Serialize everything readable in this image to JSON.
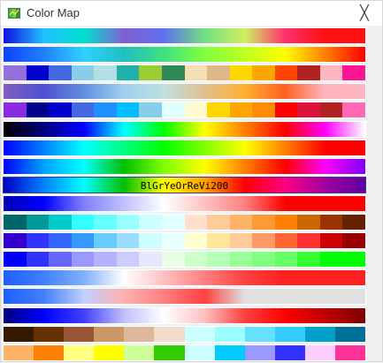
{
  "window": {
    "title": "Color Map",
    "close_glyph": "╳",
    "app_icon": "map-icon"
  },
  "colormaps": [
    {
      "type": "gradient",
      "stops": [
        "#1010e0",
        "#20c0ff",
        "#00e0d0",
        "#8060d0",
        "#6070f0",
        "#70e080",
        "#d0f060",
        "#ff3070",
        "#ff1010",
        "#ff1010"
      ]
    },
    {
      "type": "gradient",
      "stops": [
        "#1040ff",
        "#2080ff",
        "#30d0ff",
        "#20c0c0",
        "#40e080",
        "#80ff40",
        "#c0ff20",
        "#ffff00",
        "#ff8000",
        "#ff0000"
      ]
    },
    {
      "type": "discrete",
      "colors": [
        "#9370db",
        "#0000cd",
        "#4169e1",
        "#87ceeb",
        "#b0e0e6",
        "#20b2aa",
        "#9acd32",
        "#2e8b57",
        "#f5deb3",
        "#deb887",
        "#ffd700",
        "#ffa500",
        "#ff4500",
        "#b22222",
        "#ffb6c1",
        "#ff1493"
      ]
    },
    {
      "type": "gradient",
      "stops": [
        "#8060c0",
        "#5050d0",
        "#6090e0",
        "#a0d0f0",
        "#c0e0e0",
        "#e0c090",
        "#ffb030",
        "#ff6020",
        "#ffb6c1",
        "#ffb6c1"
      ]
    },
    {
      "type": "discrete",
      "colors": [
        "#8a2be2",
        "#00008b",
        "#0000cd",
        "#4169e1",
        "#1e90ff",
        "#00bfff",
        "#87ceeb",
        "#e0ffff",
        "#fffacd",
        "#ffd700",
        "#ffa500",
        "#ff8c00",
        "#ff0000",
        "#dc143c",
        "#b22222",
        "#ff69b4"
      ]
    },
    {
      "type": "gradient",
      "stops": [
        "#000000",
        "#000080",
        "#0000ff",
        "#00ffff",
        "#00ff00",
        "#ffff00",
        "#ff8000",
        "#ff0000",
        "#ff00ff",
        "#ffffff"
      ]
    },
    {
      "type": "gradient",
      "stops": [
        "#0000ff",
        "#0080ff",
        "#00ffff",
        "#00ff80",
        "#00ff00",
        "#80ff00",
        "#ffff00",
        "#ff8000",
        "#ff0000",
        "#ff0000"
      ]
    },
    {
      "type": "gradient",
      "stops": [
        "#0000ff",
        "#00a0ff",
        "#00ffff",
        "#00c000",
        "#80ff00",
        "#ffff00",
        "#ff8000",
        "#ff0000",
        "#ff00ff",
        "#8000ff"
      ]
    },
    {
      "type": "gradient",
      "label": "BlGrYeOrReVi200",
      "selected": true,
      "stops": [
        "#0000c0",
        "#0080ff",
        "#00ffff",
        "#00c000",
        "#ffff00",
        "#ffa000",
        "#ff0000",
        "#ff0080",
        "#a000a0",
        "#6000a0"
      ]
    },
    {
      "type": "gradient",
      "stops": [
        "#0000b0",
        "#0000ff",
        "#8080ff",
        "#c0c0ff",
        "#ffffff",
        "#ffc0c0",
        "#ff8080",
        "#ff0000",
        "#ff0000",
        "#ff0000"
      ]
    },
    {
      "type": "discrete",
      "colors": [
        "#006666",
        "#009999",
        "#00cccc",
        "#33ffff",
        "#66ffff",
        "#99ffff",
        "#ccffff",
        "#e0ffff",
        "#ffe0cc",
        "#ffcc99",
        "#ffb366",
        "#ff9933",
        "#ff8000",
        "#cc6600",
        "#993300",
        "#662200"
      ]
    },
    {
      "type": "discrete",
      "colors": [
        "#3300cc",
        "#3333ff",
        "#3366ff",
        "#3399ff",
        "#66ccff",
        "#99ddff",
        "#ccffff",
        "#e6ffff",
        "#ffffcc",
        "#ffe699",
        "#ffcc99",
        "#ff9966",
        "#ff6633",
        "#ff3333",
        "#cc0000",
        "#990000"
      ]
    },
    {
      "type": "discrete",
      "colors": [
        "#0000ff",
        "#3333ff",
        "#6666ff",
        "#9999ff",
        "#b3b3ff",
        "#ccccff",
        "#e6e6ff",
        "#e6ffe6",
        "#ccffcc",
        "#b3ffb3",
        "#99ff99",
        "#80ff80",
        "#66ff66",
        "#33ff33",
        "#00ff00",
        "#00ff00"
      ]
    },
    {
      "type": "gradient",
      "stops": [
        "#2060ff",
        "#4080ff",
        "#80b0ff",
        "#ffffff",
        "#ffc0c0",
        "#ff8080",
        "#ff4040",
        "#ff2020",
        "#ff2020",
        "#ff2020"
      ]
    },
    {
      "type": "gradient",
      "stops": [
        "#2060ff",
        "#4080ff",
        "#c0d0ff",
        "#ffb0b0",
        "#ff8080",
        "#ff4040",
        "#e0e0e0",
        "#e0e0e0",
        "#e0e0e0",
        "#e0e0e0"
      ]
    },
    {
      "type": "gradient",
      "stops": [
        "#000080",
        "#0000ff",
        "#4040ff",
        "#c0c0ff",
        "#ffffff",
        "#ffc0c0",
        "#ff4040",
        "#ff0000",
        "#c00000",
        "#800000"
      ]
    },
    {
      "type": "discrete",
      "colors": [
        "#331a00",
        "#663300",
        "#995533",
        "#cc9966",
        "#ddb89a",
        "#f0dcc8",
        "#ccffff",
        "#99ffff",
        "#66e0ff",
        "#33ccff",
        "#00a0cc",
        "#007099"
      ]
    },
    {
      "type": "discrete",
      "colors": [
        "#ffb366",
        "#ff8000",
        "#ffff80",
        "#ffff00",
        "#ccff99",
        "#33cc00",
        "#ccffff",
        "#00ccff",
        "#9999ff",
        "#3333ff",
        "#ffccff",
        "#ff3399"
      ]
    }
  ]
}
